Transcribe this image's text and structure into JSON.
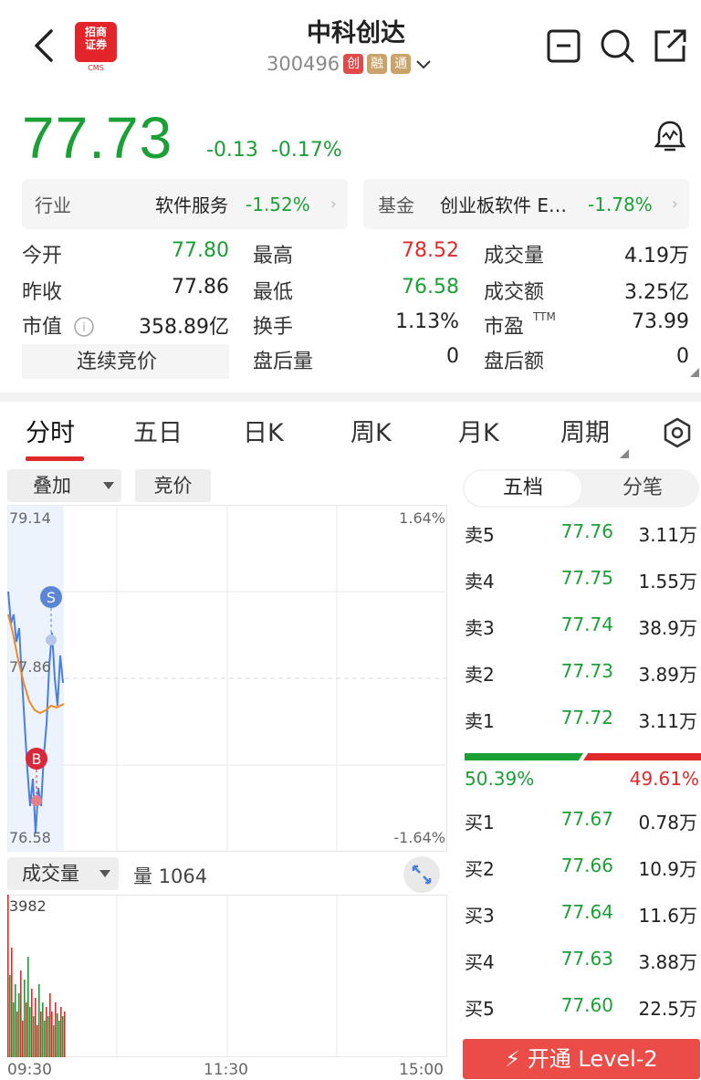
{
  "header": {
    "title": "中科创达",
    "code": "300496",
    "tags": [
      "创",
      "融",
      "通"
    ],
    "logo_text_top": "招商",
    "logo_text_bottom": "证券",
    "logo_caption": "CMS",
    "icons": [
      "back-arrow-icon",
      "minus-box-icon",
      "search-icon",
      "share-icon"
    ]
  },
  "quote": {
    "price": "77.73",
    "change": "-0.13",
    "change_pct": "-0.17%",
    "industry_label": "行业",
    "industry_name": "软件服务",
    "industry_pct": "-1.52%",
    "fund_label": "基金",
    "fund_name": "创业板软件 E…",
    "fund_pct": "-1.78%"
  },
  "stats": [
    {
      "label": "今开",
      "value": "77.80",
      "color": "#1aa035"
    },
    {
      "label": "最高",
      "value": "78.52",
      "color": "#e02a2a"
    },
    {
      "label": "成交量",
      "value": "4.19万",
      "color": "#222"
    },
    {
      "label": "昨收",
      "value": "77.86",
      "color": "#222"
    },
    {
      "label": "最低",
      "value": "76.58",
      "color": "#1aa035"
    },
    {
      "label": "成交额",
      "value": "3.25亿",
      "color": "#222"
    },
    {
      "label": "市值",
      "value": "358.89亿",
      "color": "#222"
    },
    {
      "label": "换手",
      "value": "1.13%",
      "color": "#222"
    },
    {
      "label": "市盈",
      "value": "73.99",
      "color": "#222"
    },
    {
      "label": "连续竞价",
      "value": "",
      "color": "#222"
    },
    {
      "label": "盘后量",
      "value": "0",
      "color": "#222"
    },
    {
      "label": "盘后额",
      "value": "0",
      "color": "#222"
    }
  ],
  "pe_sup": "TTM",
  "tabs": [
    "分时",
    "五日",
    "日K",
    "周K",
    "月K",
    "周期"
  ],
  "active_tab": "分时",
  "chart_controls": {
    "overlay": "叠加",
    "auction": "竞价",
    "volume": "成交量",
    "volume_text": "量 1064"
  },
  "chart_labels": {
    "y_top": "79.14",
    "y_mid": "77.86",
    "y_bot": "76.58",
    "pct_top": "1.64%",
    "pct_bot": "-1.64%",
    "vol_max": "3982",
    "t_start": "09:30",
    "t_mid": "11:30",
    "t_end": "15:00",
    "sell_mark": "S",
    "buy_mark": "B"
  },
  "orderbook": {
    "tab_active": "五档",
    "tab_other": "分笔",
    "asks": [
      {
        "label": "卖5",
        "price": "77.76",
        "vol": "3.11万"
      },
      {
        "label": "卖4",
        "price": "77.75",
        "vol": "1.55万"
      },
      {
        "label": "卖3",
        "price": "77.74",
        "vol": "38.9万"
      },
      {
        "label": "卖2",
        "price": "77.73",
        "vol": "3.89万"
      },
      {
        "label": "卖1",
        "price": "77.72",
        "vol": "3.11万"
      }
    ],
    "buy_ratio": "50.39%",
    "sell_ratio": "49.61%",
    "bids": [
      {
        "label": "买1",
        "price": "77.67",
        "vol": "0.78万"
      },
      {
        "label": "买2",
        "price": "77.66",
        "vol": "10.9万"
      },
      {
        "label": "买3",
        "price": "77.64",
        "vol": "11.6万"
      },
      {
        "label": "买4",
        "price": "77.63",
        "vol": "3.88万"
      },
      {
        "label": "买5",
        "price": "77.60",
        "vol": "22.5万"
      }
    ],
    "level2_button": "开通 Level-2"
  },
  "colors": {
    "up": "#e02a2a",
    "down": "#1aa035",
    "price_line": "#4a7fe0",
    "avg_line": "#f08a24"
  }
}
